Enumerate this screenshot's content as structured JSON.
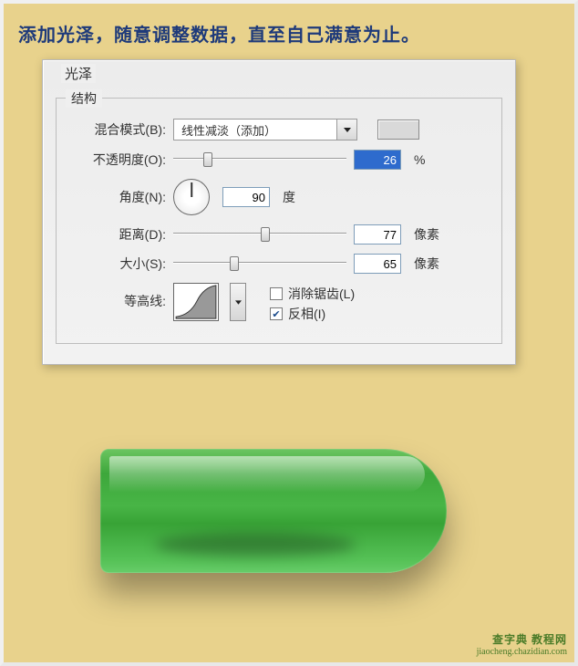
{
  "caption": "添加光泽，随意调整数据，直至自己满意为止。",
  "panel": {
    "title": "光泽",
    "section_title": "结构",
    "blend_mode": {
      "label": "混合模式(B):",
      "value": "线性减淡（添加）"
    },
    "opacity": {
      "label": "不透明度(O):",
      "value": "26",
      "unit": "%",
      "thumb_pct": 20
    },
    "angle": {
      "label": "角度(N):",
      "value": "90",
      "unit": "度"
    },
    "distance": {
      "label": "距离(D):",
      "value": "77",
      "unit": "像素",
      "thumb_pct": 53
    },
    "size": {
      "label": "大小(S):",
      "value": "65",
      "unit": "像素",
      "thumb_pct": 35
    },
    "contour": {
      "label": "等高线:",
      "anti_alias": {
        "label": "消除锯齿(L)",
        "checked": false
      },
      "invert": {
        "label": "反相(I)",
        "checked": true
      }
    }
  },
  "watermark": {
    "line1": "查字典  教程网",
    "line2": "jiaocheng.chazidian.com"
  }
}
